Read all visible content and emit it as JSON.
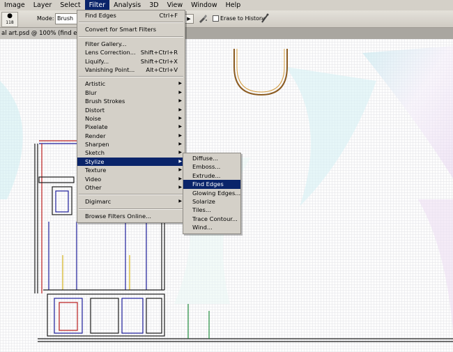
{
  "menubar": {
    "items": [
      "Image",
      "Layer",
      "Select",
      "Filter",
      "Analysis",
      "3D",
      "View",
      "Window",
      "Help"
    ],
    "active": "Filter"
  },
  "options": {
    "preset_size": "118",
    "mode_label": "Mode:",
    "mode_value": "Brush",
    "erase_label": "Erase to History"
  },
  "document": {
    "tab_title": "al art.psd @ 100% (find ed"
  },
  "filter_menu": {
    "last_filter": {
      "label": "Find Edges",
      "shortcut": "Ctrl+F"
    },
    "convert": "Convert for Smart Filters",
    "group1": [
      {
        "label": "Filter Gallery...",
        "shortcut": ""
      },
      {
        "label": "Lens Correction...",
        "shortcut": "Shift+Ctrl+R"
      },
      {
        "label": "Liquify...",
        "shortcut": "Shift+Ctrl+X"
      },
      {
        "label": "Vanishing Point...",
        "shortcut": "Alt+Ctrl+V"
      }
    ],
    "submenus": [
      "Artistic",
      "Blur",
      "Brush Strokes",
      "Distort",
      "Noise",
      "Pixelate",
      "Render",
      "Sharpen",
      "Sketch",
      "Stylize",
      "Texture",
      "Video",
      "Other"
    ],
    "highlighted": "Stylize",
    "digimarc": "Digimarc",
    "browse": "Browse Filters Online..."
  },
  "stylize_menu": {
    "items": [
      "Diffuse...",
      "Emboss...",
      "Extrude...",
      "Find Edges",
      "Glowing Edges...",
      "Solarize",
      "Tiles...",
      "Trace Contour...",
      "Wind..."
    ],
    "highlighted": "Find Edges"
  },
  "colors": {
    "menu_bg": "#d4d0c8",
    "highlight": "#0a246a",
    "canvas_bg": "#fdfdfd"
  }
}
